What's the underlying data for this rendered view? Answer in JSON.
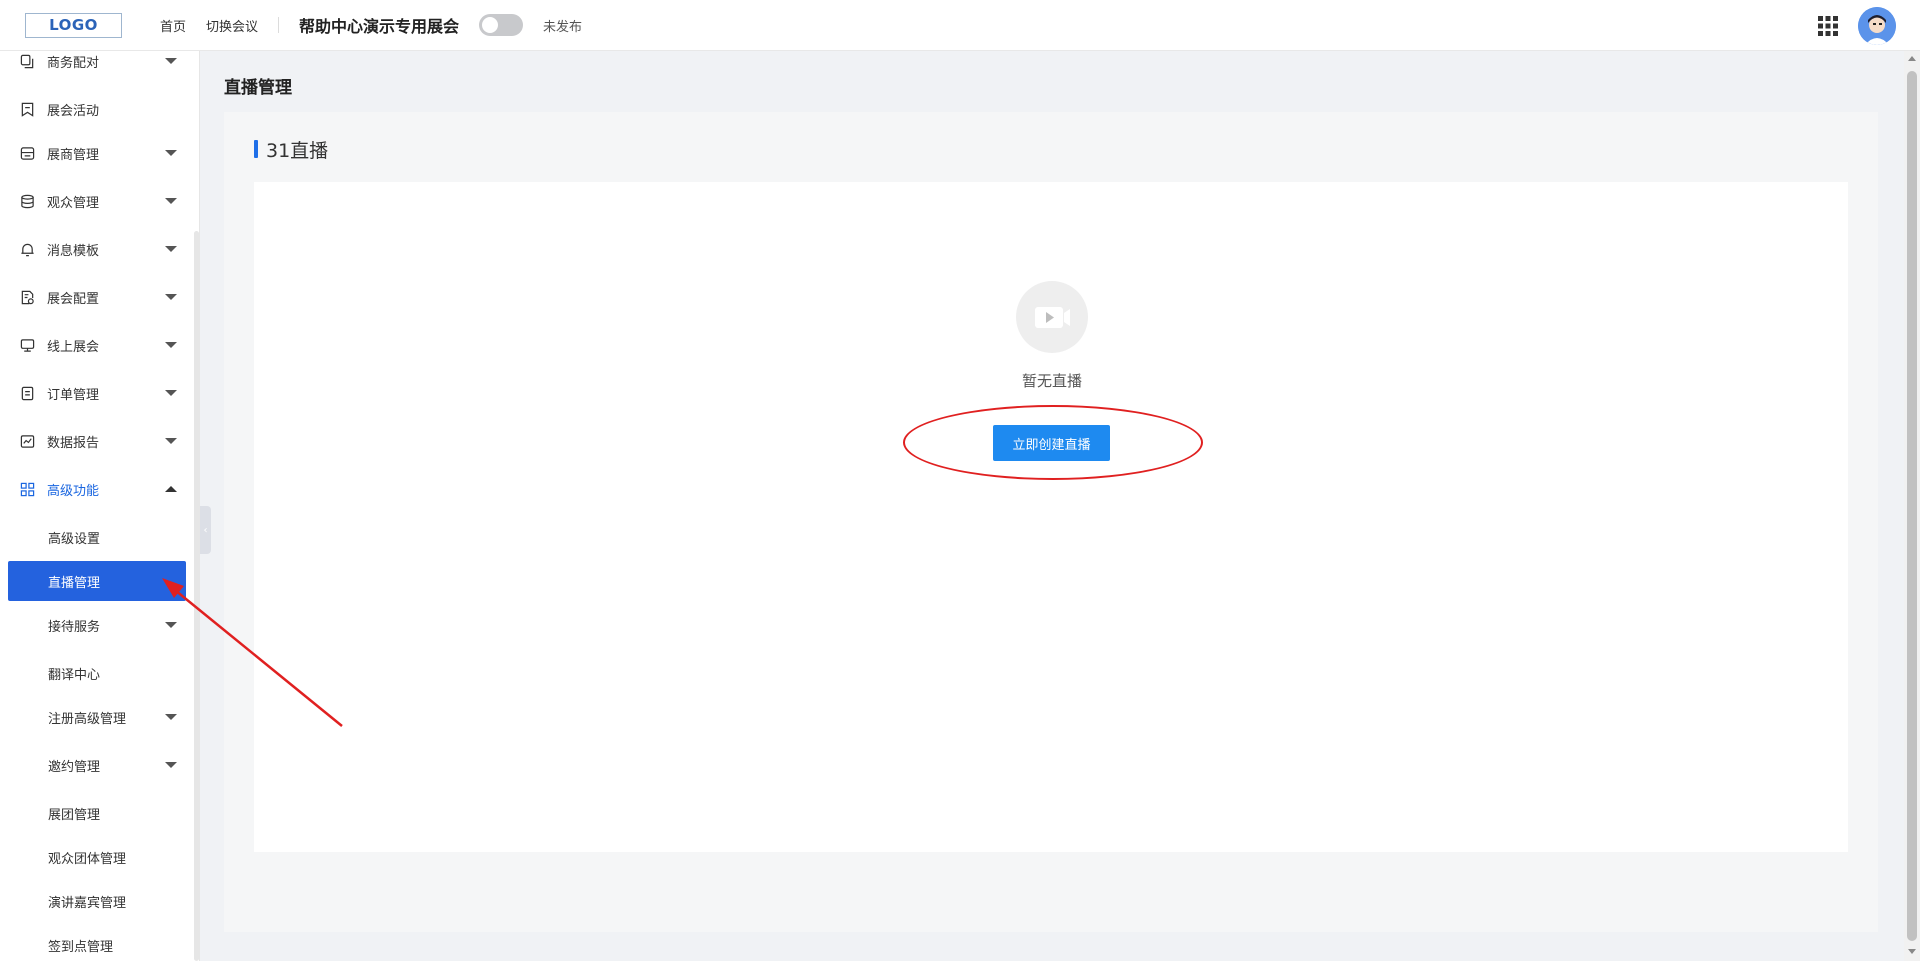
{
  "header": {
    "logo_text": "LOGO",
    "nav_home": "首页",
    "nav_switch": "切换会议",
    "expo_title": "帮助中心演示专用展会",
    "publish_status": "未发布",
    "publish_toggle_on": false
  },
  "sidebar": {
    "items": [
      {
        "label": "商务配对",
        "icon": "copy-icon",
        "has_caret": true
      },
      {
        "label": "展会活动",
        "icon": "bookmark-icon",
        "has_caret": false
      },
      {
        "label": "展商管理",
        "icon": "store-icon",
        "has_caret": true
      },
      {
        "label": "观众管理",
        "icon": "database-icon",
        "has_caret": true
      },
      {
        "label": "消息模板",
        "icon": "bell-icon",
        "has_caret": true
      },
      {
        "label": "展会配置",
        "icon": "file-settings-icon",
        "has_caret": true
      },
      {
        "label": "线上展会",
        "icon": "monitor-icon",
        "has_caret": true
      },
      {
        "label": "订单管理",
        "icon": "document-icon",
        "has_caret": true
      },
      {
        "label": "数据报告",
        "icon": "chart-icon",
        "has_caret": true
      },
      {
        "label": "高级功能",
        "icon": "apps-icon",
        "has_caret": true,
        "expanded": true
      }
    ],
    "subitems": [
      {
        "label": "高级设置",
        "has_caret": false
      },
      {
        "label": "直播管理",
        "has_caret": false,
        "active": true
      },
      {
        "label": "接待服务",
        "has_caret": true
      },
      {
        "label": "翻译中心",
        "has_caret": false
      },
      {
        "label": "注册高级管理",
        "has_caret": true
      },
      {
        "label": "邀约管理",
        "has_caret": true
      },
      {
        "label": "展团管理",
        "has_caret": false
      },
      {
        "label": "观众团体管理",
        "has_caret": false
      },
      {
        "label": "演讲嘉宾管理",
        "has_caret": false
      },
      {
        "label": "签到点管理",
        "has_caret": false
      }
    ]
  },
  "main": {
    "page_title": "直播管理",
    "section_title": "31直播",
    "empty_text": "暂无直播",
    "create_button": "立即创建直播",
    "empty_icon": "video-camera-icon"
  },
  "colors": {
    "accent": "#1e8af0",
    "active_menu": "#2462de",
    "annotation": "#e02020"
  }
}
